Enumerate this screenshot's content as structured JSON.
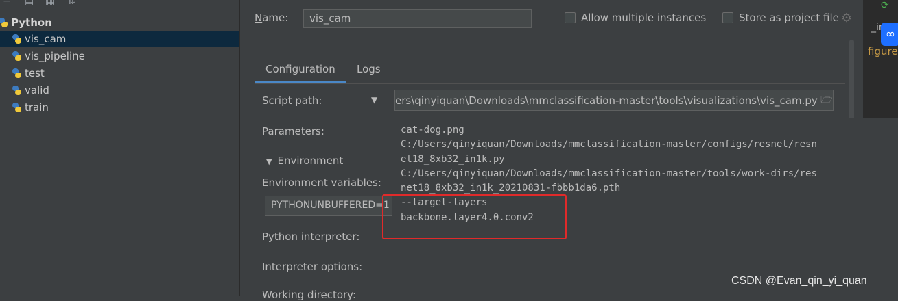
{
  "tree": {
    "root_label": "Python",
    "items": [
      {
        "label": "vis_cam"
      },
      {
        "label": "vis_pipeline"
      },
      {
        "label": "test"
      },
      {
        "label": "valid"
      },
      {
        "label": "train"
      }
    ],
    "toolbar_icons": [
      "minus-icon",
      "copy-icon",
      "folder-add-icon",
      "sort-icon"
    ]
  },
  "config": {
    "name_label_prefix": "N",
    "name_label_rest": "ame:",
    "name_value": "vis_cam",
    "allow_multiple_label": "Allow multiple instances",
    "store_project_label": "Store as project file",
    "tabs": [
      {
        "label": "Configuration"
      },
      {
        "label": "Logs"
      }
    ],
    "script_path_label": "Script path:",
    "script_path_value": "ers\\qinyiquan\\Downloads\\mmclassification-master\\tools\\visualizations\\vis_cam.py",
    "parameters_label": "Parameters:",
    "environment_label": "Environment",
    "env_vars_label": "Environment variables:",
    "env_vars_value": "PYTHONUNBUFFERED=1",
    "python_interpreter_label": "Python interpreter:",
    "interpreter_options_label": "Interpreter options:",
    "working_directory_label": "Working directory:"
  },
  "parameters_popup": {
    "lines": [
      "cat-dog.png",
      "C:/Users/qinyiquan/Downloads/mmclassification-master/configs/resnet/resn",
      "et18_8xb32_in1k.py",
      "C:/Users/qinyiquan/Downloads/mmclassification-master/tools/work-dirs/res",
      "net18_8xb32_in1k_20210831-fbbb1da6.pth",
      "--target-layers",
      "backbone.layer4.0.conv2"
    ]
  },
  "right_strip": {
    "text_in": "_in",
    "text_fig": "figure"
  },
  "watermark": "CSDN @Evan_qin_yi_quan",
  "colors": {
    "selection": "#0d293e",
    "highlight_box": "#e02a2a",
    "tab_underline": "#4a88c7"
  }
}
